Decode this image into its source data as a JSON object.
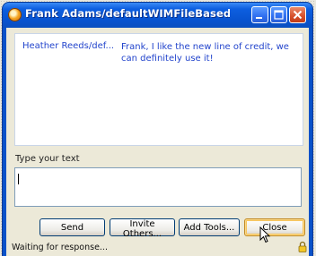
{
  "window": {
    "title": "Frank Adams/defaultWIMFileBasedRealm [started:...",
    "controls": {
      "minimize": "minimize-icon",
      "maximize": "maximize-icon",
      "close": "close-icon"
    }
  },
  "conversation": {
    "messages": [
      {
        "sender": "Heather Reeds/def...",
        "text": "Frank, I like the new line of credit, we can definitely use it!"
      }
    ]
  },
  "compose": {
    "label": "Type your text",
    "value": ""
  },
  "buttons": {
    "send": "Send",
    "invite": "Invite Others...",
    "tools": "Add Tools...",
    "close": "Close"
  },
  "status": {
    "text": "Waiting for response...",
    "icon": "lock-icon"
  },
  "colors": {
    "titlebar": "#0853d0",
    "message_text": "#2244cc",
    "close_button": "#d6502c"
  }
}
